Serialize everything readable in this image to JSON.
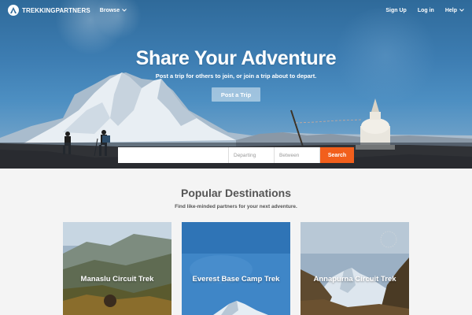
{
  "nav": {
    "logo_text": "TREKKINGPARTNERS",
    "browse_label": "Browse",
    "signup_label": "Sign Up",
    "login_label": "Log in",
    "help_label": "Help"
  },
  "hero": {
    "title": "Share Your Adventure",
    "subtitle": "Post a trip for others to join, or join a trip about to depart.",
    "post_button": "Post a Trip"
  },
  "search": {
    "departing_placeholder": "Departing",
    "between_placeholder": "Between",
    "button_label": "Search"
  },
  "destinations": {
    "title": "Popular Destinations",
    "subtitle": "Find like-minded partners for your next adventure.",
    "cards": [
      {
        "label": "Manaslu Circuit Trek"
      },
      {
        "label": "Everest Base Camp Trek"
      },
      {
        "label": "Annapurna Circuit Trek"
      }
    ]
  },
  "colors": {
    "accent": "#f25f1c",
    "hero_sky": "#3d7db2",
    "page_bg": "#f4f4f4",
    "heading_text": "#555555"
  },
  "icons": {
    "logo": "trekker-logo-icon",
    "browse": "chevron-down-icon",
    "help": "chevron-down-icon"
  }
}
